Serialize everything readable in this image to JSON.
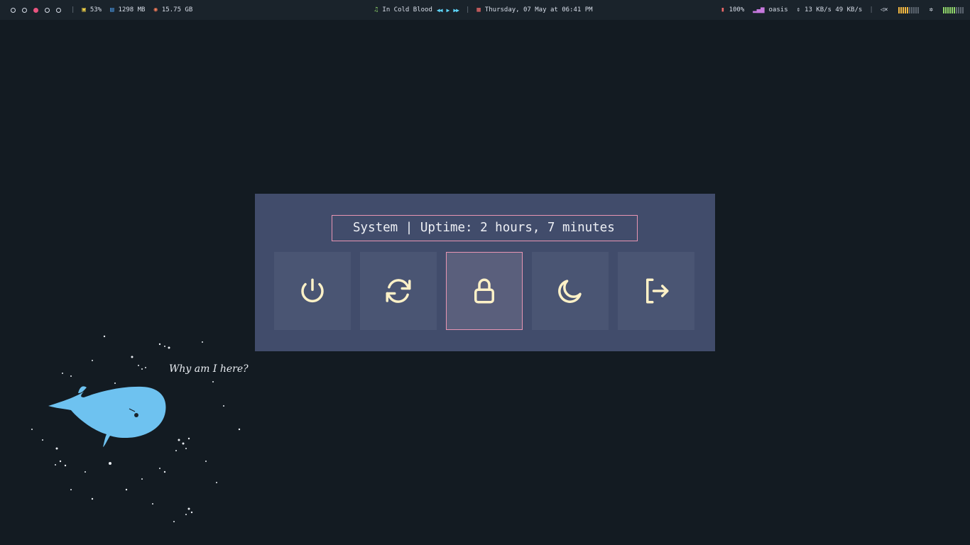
{
  "topbar": {
    "workspaces": [
      {
        "active": false
      },
      {
        "active": false
      },
      {
        "active": true
      },
      {
        "active": false
      },
      {
        "active": false
      }
    ],
    "cpu": {
      "icon": "cpu-icon",
      "value": "53%",
      "color": "#f5d547"
    },
    "ram": {
      "icon": "memory-icon",
      "value": "1298 MB",
      "color": "#4fa3f7"
    },
    "disk": {
      "icon": "disk-icon",
      "value": "15.75 GB",
      "color": "#f07b5a"
    },
    "music": {
      "icon": "music-note-icon",
      "track": "In Cold Blood",
      "color": "#8fd46a"
    },
    "datetime": {
      "icon": "calendar-icon",
      "text": "Thursday, 07 May at 06:41 PM",
      "color": "#f06a6a"
    },
    "battery": {
      "icon": "battery-icon",
      "value": "100%",
      "color": "#f06a6a"
    },
    "network": {
      "icon": "wifi-signal-icon",
      "ssid": "oasis",
      "color": "#c678dd"
    },
    "traffic": {
      "icon": "up-down-arrows-icon",
      "text": "13 KB/s 49 KB/s"
    },
    "volume": {
      "icon": "speaker-muted-icon",
      "level": 0.5,
      "color": "#f5b942"
    },
    "brightness": {
      "icon": "brightness-icon",
      "level": 0.6,
      "color": "#8fd46a"
    }
  },
  "menu": {
    "prompt": "System | Uptime: 2 hours, 7 minutes",
    "buttons": [
      {
        "name": "shutdown",
        "icon": "power-icon",
        "selected": false
      },
      {
        "name": "reboot",
        "icon": "refresh-icon",
        "selected": false
      },
      {
        "name": "lock",
        "icon": "lock-icon",
        "selected": true
      },
      {
        "name": "suspend",
        "icon": "moon-icon",
        "selected": false
      },
      {
        "name": "logout",
        "icon": "logout-icon",
        "selected": false
      }
    ],
    "icon_color": "#fdf1c7",
    "accent": "#e895b3"
  },
  "wallpaper": {
    "caption": "Why am I here?"
  }
}
